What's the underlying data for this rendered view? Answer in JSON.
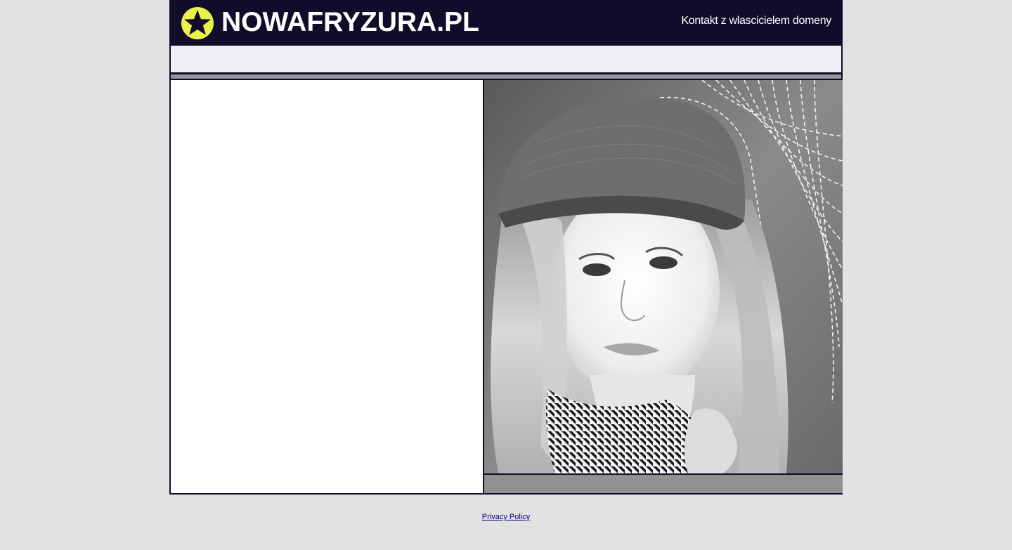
{
  "header": {
    "site_title": "NOWAFRYZURA.PL",
    "contact_link": "Kontakt z wlascicielem domeny",
    "logo_icon": "star-in-circle-icon",
    "colors": {
      "header_bg": "#120c2b",
      "logo_circle": "#e8f24a",
      "logo_star": "#120c2b"
    }
  },
  "photo": {
    "icon": "woman-portrait-photo"
  },
  "footer": {
    "privacy_link": "Privacy Policy"
  }
}
